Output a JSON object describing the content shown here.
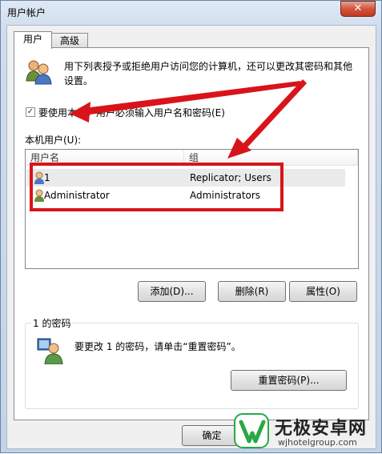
{
  "window": {
    "title": "用户帐户",
    "close_glyph": "✕"
  },
  "tabs": [
    {
      "label": "用户"
    },
    {
      "label": "高级"
    }
  ],
  "intro": {
    "line1": "用下列表授予或拒绝用户访问您的计算机，还可以更改其密码和其他",
    "line2": "设置。"
  },
  "require_login": {
    "label": "要使用本机，用户必须输入用户名和密码(E)",
    "checked": true,
    "check_glyph": "✓"
  },
  "users_section": {
    "label": "本机用户(U):",
    "columns": [
      "用户名",
      "组"
    ],
    "rows": [
      {
        "name": "1",
        "group": "Replicator; Users"
      },
      {
        "name": "Administrator",
        "group": "Administrators"
      }
    ]
  },
  "buttons": {
    "add": "添加(D)...",
    "remove": "删除(R)",
    "properties": "属性(O)"
  },
  "password_group": {
    "title": "1 的密码",
    "text": "要更改 1 的密码，请单击“重置密码”。",
    "reset_button": "重置密码(P)..."
  },
  "footer": {
    "ok": "确定"
  },
  "watermark": {
    "brand": "无极安卓网",
    "url": "wjhotelgroup.com"
  },
  "colors": {
    "annotation_red": "#d8141a",
    "brand_green": "#2aa845"
  }
}
